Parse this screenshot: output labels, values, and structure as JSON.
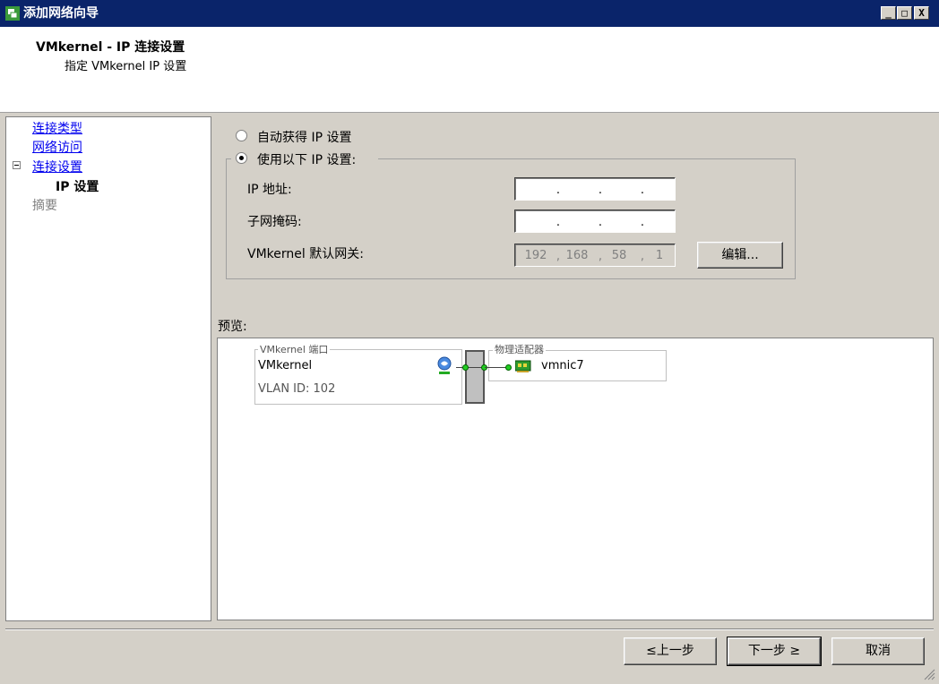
{
  "window": {
    "title": "添加网络向导",
    "controls": {
      "minimize": "_",
      "maximize": "□",
      "close": "X"
    }
  },
  "header": {
    "title": "VMkernel - IP 连接设置",
    "subtitle": "指定 VMkernel IP 设置"
  },
  "nav": {
    "items": [
      {
        "label": "连接类型"
      },
      {
        "label": "网络访问"
      },
      {
        "label": "连接设置",
        "toggle": "−"
      },
      {
        "label": "IP 设置"
      },
      {
        "label": "摘要"
      }
    ]
  },
  "ip_settings": {
    "auto_option": "自动获得 IP 设置",
    "manual_option": "使用以下 IP 设置:",
    "selected": "manual",
    "ip_label": "IP 地址:",
    "ip_value": [
      "",
      "",
      "",
      ""
    ],
    "mask_label": "子网掩码:",
    "mask_value": [
      "",
      "",
      "",
      ""
    ],
    "gateway_label": "VMkernel 默认网关:",
    "gateway_value": [
      "192",
      "168",
      "58",
      "1"
    ],
    "edit_button": "编辑..."
  },
  "preview": {
    "label": "预览:",
    "port_group_legend": "VMkernel 端口",
    "port_name": "VMkernel",
    "vlan": "VLAN ID: 102",
    "adapter_legend": "物理适配器",
    "adapter_name": "vmnic7"
  },
  "footer": {
    "back": "≤上一步",
    "next": "下一步 ≥",
    "cancel": "取消"
  }
}
